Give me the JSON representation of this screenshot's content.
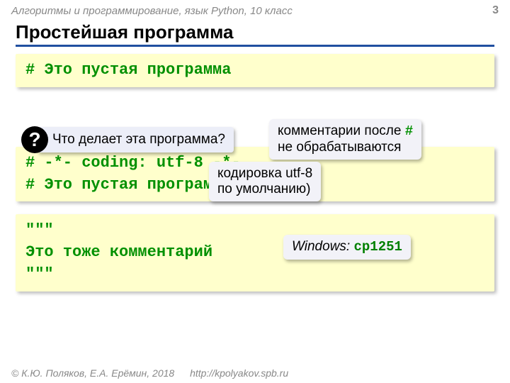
{
  "header": {
    "course": "Алгоритмы и программирование, язык Python, 10 класс",
    "page": "3"
  },
  "title": "Простейшая программа",
  "code1": "# Это пустая программа",
  "question": {
    "mark": "?",
    "text": "Что делает эта программа?"
  },
  "callouts": {
    "comments_pre": "комментарии после ",
    "comments_hash": "#",
    "comments_post": "не обрабатываются",
    "encoding_l1": "кодировка utf-8",
    "encoding_l2": "по умолчанию)",
    "windows_label": "Windows:",
    "windows_value": "cp1251"
  },
  "code2_l1": "# -*- coding: utf-8 -*-",
  "code2_l2": "# Это пустая программа",
  "code3_l1": "\"\"\"",
  "code3_l2": "Это тоже комментарий",
  "code3_l3": "\"\"\"",
  "footer": {
    "copyright": "© К.Ю. Поляков, Е.А. Ерёмин, 2018",
    "url": "http://kpolyakov.spb.ru"
  }
}
